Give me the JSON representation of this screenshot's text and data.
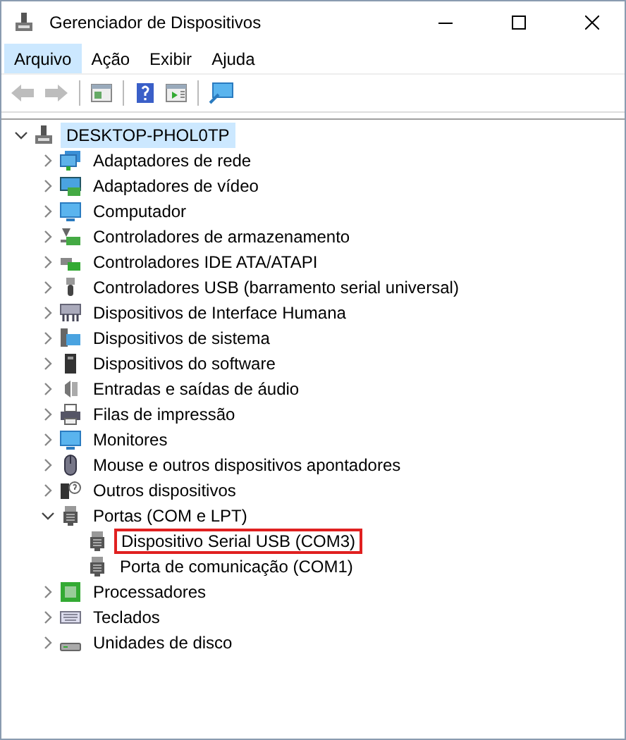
{
  "window": {
    "title": "Gerenciador de Dispositivos"
  },
  "menu": [
    {
      "label": "Arquivo",
      "selected": true
    },
    {
      "label": "Ação",
      "selected": false
    },
    {
      "label": "Exibir",
      "selected": false
    },
    {
      "label": "Ajuda",
      "selected": false
    }
  ],
  "toolbar": [
    {
      "kind": "back",
      "disabled": true
    },
    {
      "kind": "forward",
      "disabled": true
    },
    {
      "kind": "separator"
    },
    {
      "kind": "properties",
      "disabled": false
    },
    {
      "kind": "separator"
    },
    {
      "kind": "help",
      "disabled": false
    },
    {
      "kind": "update",
      "disabled": false
    },
    {
      "kind": "separator"
    },
    {
      "kind": "scan",
      "disabled": false
    }
  ],
  "tree": {
    "label": "DESKTOP-PHOL0TP",
    "kind": "computer-root",
    "expanded": true,
    "selected": true,
    "children": [
      {
        "label": "Adaptadores de rede",
        "kind": "network",
        "expanded": false
      },
      {
        "label": "Adaptadores de vídeo",
        "kind": "display",
        "expanded": false
      },
      {
        "label": "Computador",
        "kind": "monitor",
        "expanded": false
      },
      {
        "label": "Controladores de armazenamento",
        "kind": "storage",
        "expanded": false
      },
      {
        "label": "Controladores IDE ATA/ATAPI",
        "kind": "card",
        "expanded": false
      },
      {
        "label": "Controladores USB (barramento serial universal)",
        "kind": "usb",
        "expanded": false
      },
      {
        "label": "Dispositivos de Interface Humana",
        "kind": "hid",
        "expanded": false
      },
      {
        "label": "Dispositivos de sistema",
        "kind": "system",
        "expanded": false
      },
      {
        "label": "Dispositivos do software",
        "kind": "software",
        "expanded": false
      },
      {
        "label": "Entradas e saídas de áudio",
        "kind": "audio",
        "expanded": false
      },
      {
        "label": "Filas de impressão",
        "kind": "printer",
        "expanded": false
      },
      {
        "label": "Monitores",
        "kind": "monitor",
        "expanded": false
      },
      {
        "label": "Mouse e outros dispositivos apontadores",
        "kind": "mouse",
        "expanded": false
      },
      {
        "label": "Outros dispositivos",
        "kind": "other",
        "expanded": false
      },
      {
        "label": "Portas (COM e LPT)",
        "kind": "port",
        "expanded": true,
        "children": [
          {
            "label": "Dispositivo Serial USB (COM3)",
            "kind": "port",
            "highlighted": true
          },
          {
            "label": "Porta de comunicação (COM1)",
            "kind": "port",
            "highlighted": false
          }
        ]
      },
      {
        "label": "Processadores",
        "kind": "processor",
        "expanded": false
      },
      {
        "label": "Teclados",
        "kind": "keyboard",
        "expanded": false
      },
      {
        "label": "Unidades de disco",
        "kind": "disk",
        "expanded": false
      }
    ]
  }
}
